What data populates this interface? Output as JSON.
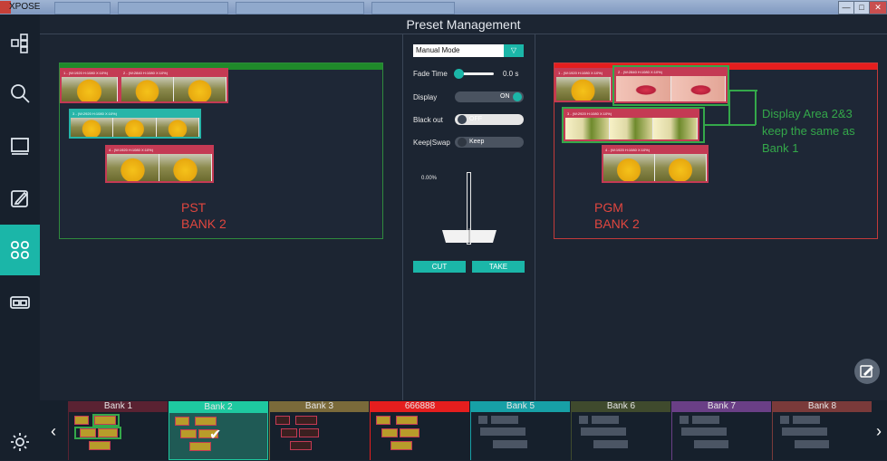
{
  "window": {
    "app_name": "XPOSE",
    "min": "—",
    "max": "□",
    "close": "✕"
  },
  "header": {
    "title": "Preset Management"
  },
  "sidebar": {
    "items": [
      {
        "name": "layout-icon"
      },
      {
        "name": "search-icon"
      },
      {
        "name": "monitor-icon"
      },
      {
        "name": "edit-icon"
      },
      {
        "name": "preset-grid-icon"
      },
      {
        "name": "output-icon"
      },
      {
        "name": "settings-icon"
      }
    ]
  },
  "pst": {
    "note_line1": "PST",
    "note_line2": "BANK 2",
    "layers": [
      {
        "label": "1 - (W:1920 H:1080 X:10%)"
      },
      {
        "label": "2 - (W:2840 H:1080 X:10%)"
      },
      {
        "label": "3 - (W:2920 H:1080 X:10%)"
      },
      {
        "label": "4 - (W:1920 H:1080 X:10%)"
      }
    ]
  },
  "pgm": {
    "note_line1": "PGM",
    "note_line2": "BANK 2",
    "annotation_line1": "Display Area 2&3",
    "annotation_line2": "keep the same as",
    "annotation_line3": "Bank 1",
    "layers": [
      {
        "label": "1 - (W:1920 H:1080 X:10%)"
      },
      {
        "label": "2 - (W:2840 H:1080 X:10%)"
      },
      {
        "label": "3 - (W:2920 H:1080 X:10%)"
      },
      {
        "label": "4 - (W:1920 H:1080 X:10%)"
      }
    ]
  },
  "controls": {
    "mode": "Manual Mode",
    "fade_label": "Fade Time",
    "fade_value": "0.0 s",
    "display_label": "Display",
    "display_value": "ON",
    "blackout_label": "Black out",
    "blackout_value": "OFF",
    "keepswap_label": "Keep|Swap",
    "keepswap_value": "Keep",
    "tbar_percent": "0.00%",
    "cut": "CUT",
    "take": "TAKE"
  },
  "banks": [
    {
      "label": "Bank 1",
      "color": "#5a2232"
    },
    {
      "label": "Bank 2",
      "color": "#1ec9a0"
    },
    {
      "label": "Bank 3",
      "color": "#7a6a3a"
    },
    {
      "label": "666888",
      "color": "#e51e1e"
    },
    {
      "label": "Bank 5",
      "color": "#17a0a6"
    },
    {
      "label": "Bank 6",
      "color": "#3f4a2d"
    },
    {
      "label": "Bank 7",
      "color": "#6a3f86"
    },
    {
      "label": "Bank 8",
      "color": "#7a3a3a"
    }
  ],
  "colors": {
    "accent": "#1bb6a8",
    "pst_border": "#2f8a3d",
    "pgm_border": "#c33a3a",
    "annotation": "#34a84a"
  }
}
